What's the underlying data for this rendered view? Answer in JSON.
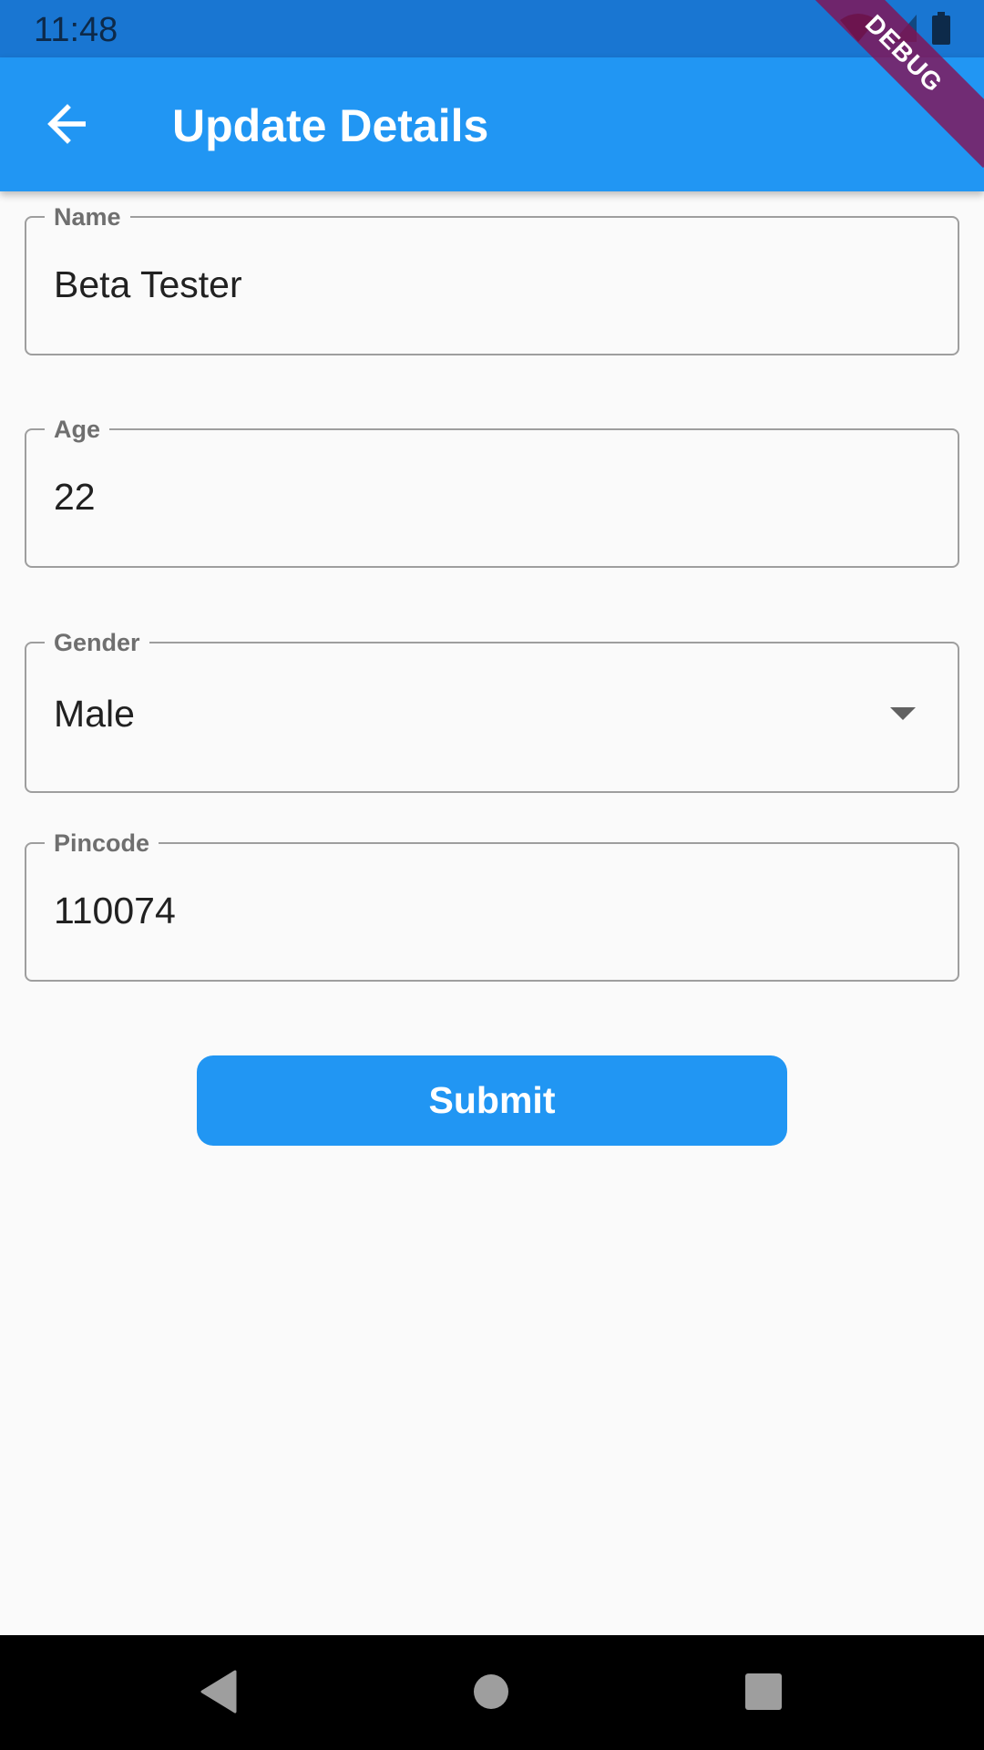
{
  "status_bar": {
    "time": "11:48",
    "icons": [
      "wifi-icon",
      "signal-icon",
      "battery-icon"
    ]
  },
  "app_bar": {
    "title": "Update Details",
    "back_icon": "arrow-back-icon"
  },
  "debug_banner": {
    "label": "DEBUG"
  },
  "form": {
    "name": {
      "label": "Name",
      "value": "Beta Tester"
    },
    "age": {
      "label": "Age",
      "value": "22"
    },
    "gender": {
      "label": "Gender",
      "value": "Male",
      "icon": "dropdown-arrow-icon"
    },
    "pincode": {
      "label": "Pincode",
      "value": "110074"
    }
  },
  "submit": {
    "label": "Submit"
  },
  "nav_bar": {
    "icons": [
      "back-triangle-icon",
      "home-circle-icon",
      "recents-square-icon"
    ]
  },
  "colors": {
    "status_bar": "#1976d2",
    "app_bar": "#2196f3",
    "button": "#2196f3",
    "background": "#fafafa"
  }
}
